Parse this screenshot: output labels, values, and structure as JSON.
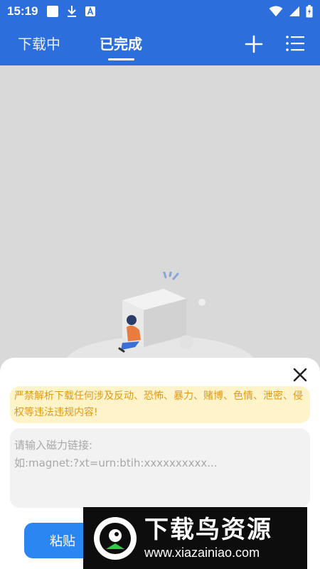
{
  "status_bar": {
    "time": "15:19",
    "left_icons": [
      "square-notification-icon",
      "download-icon",
      "app-notification-icon"
    ],
    "right_icons": [
      "wifi-icon",
      "signal-icon",
      "battery-icon"
    ]
  },
  "header": {
    "tabs": [
      {
        "label": "下载中",
        "active": false
      },
      {
        "label": "已完成",
        "active": true
      }
    ],
    "actions": [
      "plus-icon",
      "list-menu-icon"
    ]
  },
  "dialog": {
    "warning": "严禁解析下载任何涉及反动、恐怖、暴力、赌博、色情、泄密、侵权等违法违规内容!",
    "link_input": {
      "placeholder": "请输入磁力链接:\n如:magnet:?xt=urn:btih:xxxxxxxxxx...",
      "value": ""
    },
    "paste_label": "粘贴"
  },
  "watermark": {
    "title": "下载鸟资源",
    "url": "www.xiazainiao.com"
  },
  "colors": {
    "brand": "#2c6fdc",
    "button": "#2c86f2",
    "warning_bg": "#fff3c9",
    "warning_text": "#e19a13"
  }
}
